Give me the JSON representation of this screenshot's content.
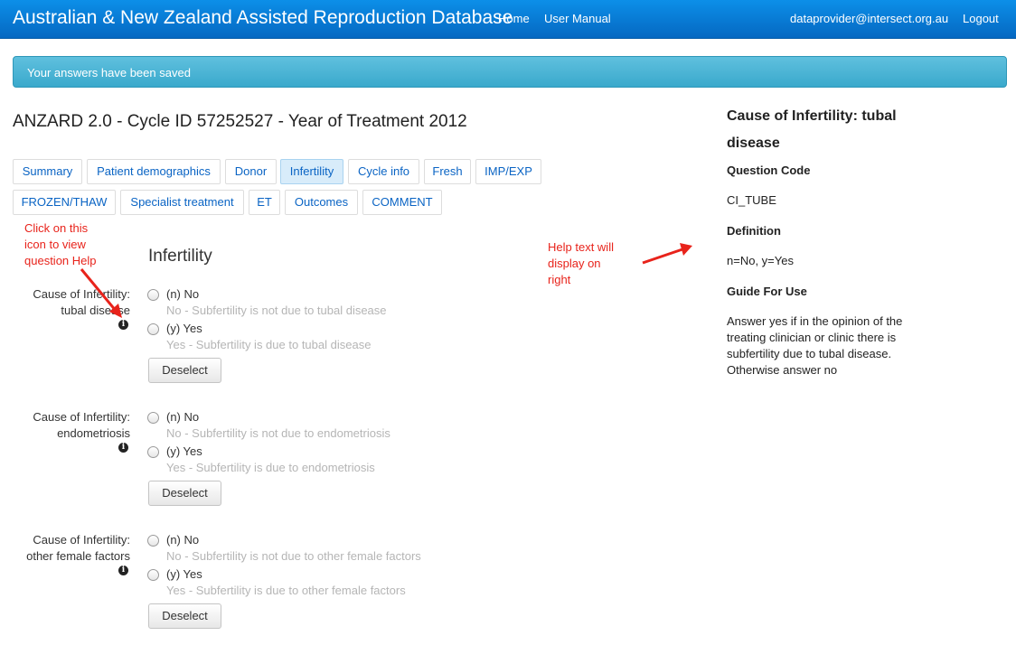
{
  "navbar": {
    "brand": "Australian & New Zealand Assisted Reproduction Database",
    "home": "Home",
    "user_manual": "User Manual",
    "user_email": "dataprovider@intersect.org.au",
    "logout": "Logout"
  },
  "alert": {
    "message": "Your answers have been saved"
  },
  "page_title": "ANZARD 2.0 - Cycle ID 57252527 - Year of Treatment 2012",
  "tabs": [
    {
      "label": "Summary"
    },
    {
      "label": "Patient demographics"
    },
    {
      "label": "Donor"
    },
    {
      "label": "Infertility",
      "active": true
    },
    {
      "label": "Cycle info"
    },
    {
      "label": "Fresh"
    },
    {
      "label": "IMP/EXP"
    },
    {
      "label": "FROZEN/THAW"
    },
    {
      "label": "Specialist treatment"
    },
    {
      "label": "ET"
    },
    {
      "label": "Outcomes"
    },
    {
      "label": "COMMENT"
    }
  ],
  "section_title": "Infertility",
  "questions": [
    {
      "label_line1": "Cause of Infertility:",
      "label_line2": "tubal disease",
      "options": [
        {
          "label": "(n) No",
          "hint": "No - Subfertility is not due to tubal disease"
        },
        {
          "label": "(y) Yes",
          "hint": "Yes - Subfertility is due to tubal disease"
        }
      ],
      "deselect_label": "Deselect"
    },
    {
      "label_line1": "Cause of Infertility:",
      "label_line2": "endometriosis",
      "options": [
        {
          "label": "(n) No",
          "hint": "No - Subfertility is not due to endometriosis"
        },
        {
          "label": "(y) Yes",
          "hint": "Yes - Subfertility is due to endometriosis"
        }
      ],
      "deselect_label": "Deselect"
    },
    {
      "label_line1": "Cause of Infertility:",
      "label_line2": "other female factors",
      "options": [
        {
          "label": "(n) No",
          "hint": "No - Subfertility is not due to other female factors"
        },
        {
          "label": "(y) Yes",
          "hint": "Yes - Subfertility is due to other female factors"
        }
      ],
      "deselect_label": "Deselect"
    }
  ],
  "info_icon_glyph": "i",
  "annotations": {
    "click_icon": [
      "Click on this",
      "icon to view",
      "question Help"
    ],
    "help_text": [
      "Help text will",
      "display on",
      "right"
    ]
  },
  "help_panel": {
    "title_line1": "Cause of Infertility: tubal",
    "title_line2": "disease",
    "code_label": "Question Code",
    "code_value": "CI_TUBE",
    "definition_label": "Definition",
    "definition_value": "n=No, y=Yes",
    "guide_label": "Guide For Use",
    "guide_lines": [
      "Answer yes if in the opinion of the",
      "treating clinician or clinic there is",
      "subfertility due to tubal disease.",
      "Otherwise answer no"
    ]
  },
  "colors": {
    "navbar": "#0a7fdc",
    "alert": "#4bb6d8",
    "annotation": "#e8231b",
    "link": "#0a64c4"
  }
}
